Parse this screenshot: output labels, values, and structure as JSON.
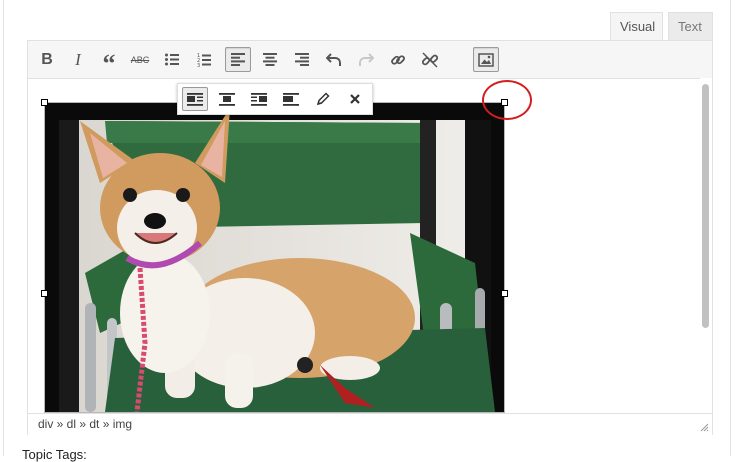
{
  "tabs": {
    "visual": "Visual",
    "text": "Text"
  },
  "toolbar": {
    "buttons": [
      {
        "name": "bold-icon",
        "glyph": "B"
      },
      {
        "name": "italic-icon",
        "glyph": "I"
      },
      {
        "name": "blockquote-icon",
        "glyph": "“"
      },
      {
        "name": "strikethrough-icon",
        "glyph": "ABC"
      },
      {
        "name": "bulleted-list-icon"
      },
      {
        "name": "numbered-list-icon"
      },
      {
        "name": "align-left-icon",
        "active": true
      },
      {
        "name": "align-center-icon"
      },
      {
        "name": "align-right-icon"
      },
      {
        "name": "undo-icon"
      },
      {
        "name": "redo-icon"
      },
      {
        "name": "insert-link-icon"
      },
      {
        "name": "remove-link-icon"
      },
      {
        "name": "toolbar-toggle-icon",
        "active": true
      }
    ]
  },
  "inline_toolbar": {
    "buttons": [
      {
        "name": "image-align-left-icon",
        "active": true
      },
      {
        "name": "image-align-center-icon"
      },
      {
        "name": "image-align-right-icon"
      },
      {
        "name": "image-align-none-icon"
      },
      {
        "name": "edit-image-pencil-icon"
      },
      {
        "name": "remove-image-close-icon"
      }
    ]
  },
  "status": {
    "path": "div » dl » dt » img"
  },
  "below_label": "Topic Tags:",
  "colors": {
    "highlight_circle": "#d21e1e",
    "chair_green": "#2f6b3e"
  }
}
